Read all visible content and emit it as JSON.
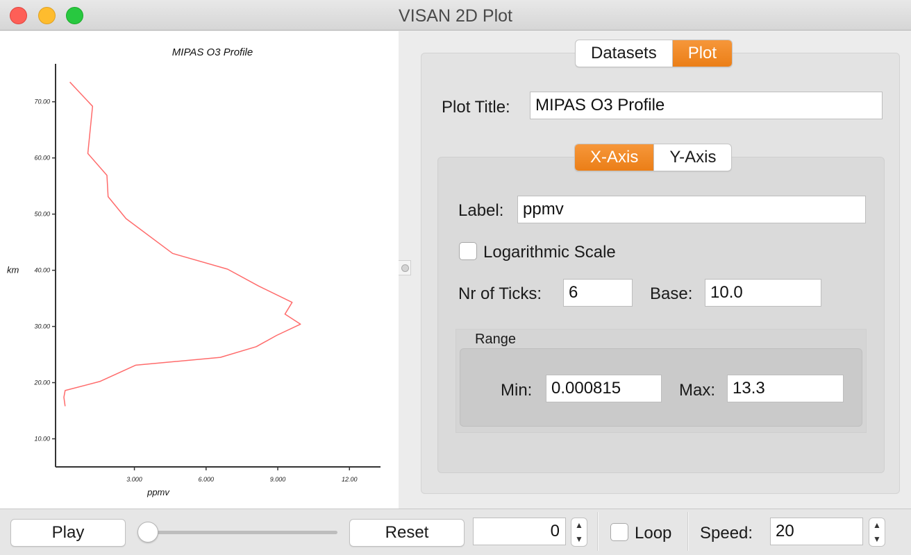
{
  "window": {
    "title": "VISAN 2D Plot"
  },
  "plot": {
    "title": "MIPAS O3 Profile",
    "xlabel": "ppmv",
    "ylabel": "km",
    "line_color": "#ff6b6b"
  },
  "chart_data": {
    "type": "line",
    "title": "MIPAS O3 Profile",
    "xlabel": "ppmv",
    "ylabel": "km",
    "xlim": [
      -0.3,
      13.3
    ],
    "ylim": [
      5,
      77
    ],
    "xticks": [
      "3.000",
      "6.000",
      "9.000",
      "12.00"
    ],
    "yticks": [
      "10.00",
      "20.00",
      "30.00",
      "40.00",
      "50.00",
      "60.00",
      "70.00"
    ],
    "grid": false,
    "series": [
      {
        "x": [
          0.3,
          1.25,
          1.05,
          1.85,
          1.9,
          2.65,
          4.6,
          6.9,
          8.2,
          9.6,
          9.3,
          9.95,
          8.95,
          8.1,
          6.6,
          3.05,
          1.55,
          0.1,
          0.05,
          0.1
        ],
        "y": [
          73.5,
          69.2,
          60.8,
          56.9,
          53.1,
          49.2,
          43.0,
          40.2,
          37.2,
          34.3,
          32.2,
          30.4,
          28.4,
          26.4,
          24.5,
          23.1,
          20.2,
          18.6,
          17.4,
          15.8
        ]
      }
    ]
  },
  "tabs_main": {
    "datasets": "Datasets",
    "plot": "Plot",
    "active": "Plot"
  },
  "plot_settings": {
    "title_label": "Plot Title:",
    "title_value": "MIPAS O3 Profile"
  },
  "axis_tabs": {
    "x_axis": "X-Axis",
    "y_axis": "Y-Axis",
    "active": "X-Axis"
  },
  "x_axis": {
    "label_label": "Label:",
    "label_value": "ppmv",
    "log_scale_label": "Logarithmic Scale",
    "log_scale_checked": false,
    "ticks_label": "Nr of Ticks:",
    "ticks_value": "6",
    "base_label": "Base:",
    "base_value": "10.0",
    "range_title": "Range",
    "min_label": "Min:",
    "min_value": "0.000815",
    "max_label": "Max:",
    "max_value": "13.3"
  },
  "toolbar": {
    "play_label": "Play",
    "slider_fraction": 0,
    "reset_label": "Reset",
    "frame_value": "0",
    "loop_label": "Loop",
    "loop_checked": false,
    "speed_label": "Speed:",
    "speed_value": "20",
    "spin_up_icon": "chevron-up-icon",
    "spin_down_icon": "chevron-down-icon"
  },
  "colors": {
    "accent": "#ef8421",
    "close": "#fe5f57",
    "minimize": "#febc2e",
    "zoom": "#28c840"
  }
}
